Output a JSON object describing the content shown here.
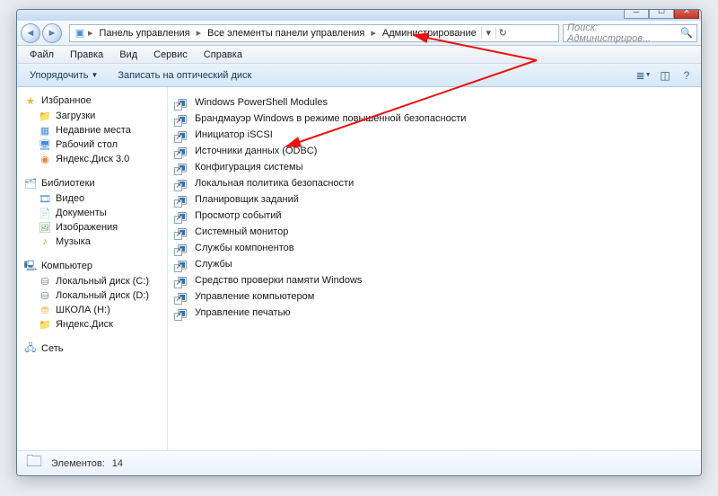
{
  "breadcrumb": {
    "root_glyph": "▣",
    "seg1": "Панель управления",
    "seg2": "Все элементы панели управления",
    "seg3": "Администрирование"
  },
  "search": {
    "placeholder": "Поиск: Администриров..."
  },
  "menu": {
    "file": "Файл",
    "edit": "Правка",
    "view": "Вид",
    "service": "Сервис",
    "help": "Справка"
  },
  "toolbar": {
    "organize": "Упорядочить",
    "burn": "Записать на оптический диск"
  },
  "sidebar": {
    "favorites": {
      "title": "Избранное",
      "items": [
        {
          "label": "Загрузки",
          "iconClass": "folder"
        },
        {
          "label": "Недавние места",
          "iconClass": "blue"
        },
        {
          "label": "Рабочий стол",
          "iconClass": "blue"
        },
        {
          "label": "Яндекс.Диск 3.0",
          "iconClass": "orange"
        }
      ]
    },
    "libraries": {
      "title": "Библиотеки",
      "items": [
        {
          "label": "Видео",
          "iconClass": "blue"
        },
        {
          "label": "Документы",
          "iconClass": "folder"
        },
        {
          "label": "Изображения",
          "iconClass": "green"
        },
        {
          "label": "Музыка",
          "iconClass": "orange"
        }
      ]
    },
    "computer": {
      "title": "Компьютер",
      "items": [
        {
          "label": "Локальный диск (C:)",
          "iconClass": "grey"
        },
        {
          "label": "Локальный диск (D:)",
          "iconClass": "grey"
        },
        {
          "label": "ШКОЛА (H:)",
          "iconClass": "folder"
        },
        {
          "label": "Яндекс.Диск",
          "iconClass": "folder"
        }
      ]
    },
    "network": {
      "title": "Сеть"
    }
  },
  "items": [
    "Windows PowerShell Modules",
    "Брандмауэр Windows в режиме повышенной безопасности",
    "Инициатор iSCSI",
    "Источники данных (ODBC)",
    "Конфигурация системы",
    "Локальная политика безопасности",
    "Планировщик заданий",
    "Просмотр событий",
    "Системный монитор",
    "Службы компонентов",
    "Службы",
    "Средство проверки памяти Windows",
    "Управление компьютером",
    "Управление печатью"
  ],
  "status": {
    "label": "Элементов:",
    "count": "14"
  }
}
